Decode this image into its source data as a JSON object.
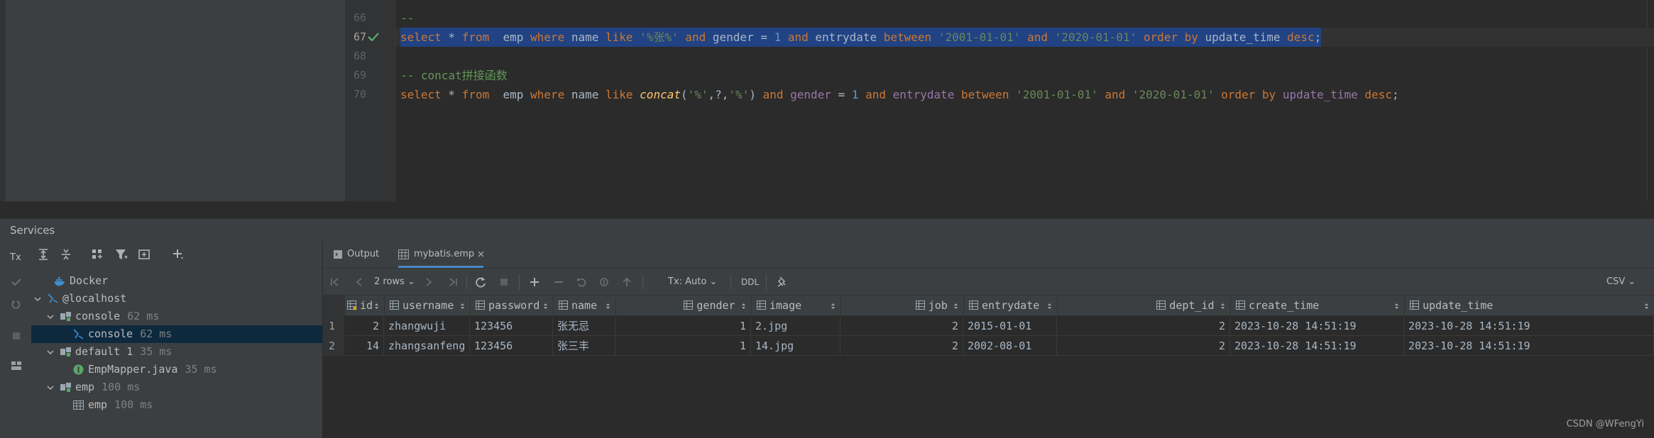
{
  "editor": {
    "lines": [
      {
        "n": "66",
        "tokens": [
          {
            "t": "--",
            "c": "cmt"
          }
        ]
      },
      {
        "n": "67",
        "current": true,
        "check": true,
        "selected": true,
        "tokens": [
          {
            "t": "select",
            "c": "kw"
          },
          {
            "t": " * "
          },
          {
            "t": "from",
            "c": "kw"
          },
          {
            "t": "  emp "
          },
          {
            "t": "where",
            "c": "kw"
          },
          {
            "t": " name "
          },
          {
            "t": "like",
            "c": "kw"
          },
          {
            "t": " "
          },
          {
            "t": "'%张%'",
            "c": "str"
          },
          {
            "t": " "
          },
          {
            "t": "and",
            "c": "kw"
          },
          {
            "t": " gender = "
          },
          {
            "t": "1",
            "c": "num-l"
          },
          {
            "t": " "
          },
          {
            "t": "and",
            "c": "kw"
          },
          {
            "t": " entrydate "
          },
          {
            "t": "between",
            "c": "kw"
          },
          {
            "t": " "
          },
          {
            "t": "'2001-01-01'",
            "c": "str"
          },
          {
            "t": " "
          },
          {
            "t": "and",
            "c": "kw"
          },
          {
            "t": " "
          },
          {
            "t": "'2020-01-01'",
            "c": "str"
          },
          {
            "t": " "
          },
          {
            "t": "order by",
            "c": "kw"
          },
          {
            "t": " update_time "
          },
          {
            "t": "desc",
            "c": "kw"
          },
          {
            "t": ";"
          }
        ]
      },
      {
        "n": "68",
        "tokens": []
      },
      {
        "n": "69",
        "tokens": [
          {
            "t": "-- concat拼接函数",
            "c": "cmt"
          }
        ]
      },
      {
        "n": "70",
        "tokens": [
          {
            "t": "select",
            "c": "kw"
          },
          {
            "t": " * "
          },
          {
            "t": "from",
            "c": "kw"
          },
          {
            "t": "  emp "
          },
          {
            "t": "where",
            "c": "kw"
          },
          {
            "t": " name "
          },
          {
            "t": "like",
            "c": "kw"
          },
          {
            "t": " "
          },
          {
            "t": "concat",
            "c": "fn"
          },
          {
            "t": "("
          },
          {
            "t": "'%'",
            "c": "str"
          },
          {
            "t": ",?,"
          },
          {
            "t": "'%'",
            "c": "str"
          },
          {
            "t": ") "
          },
          {
            "t": "and",
            "c": "kw"
          },
          {
            "t": " "
          },
          {
            "t": "gender",
            "c": "col"
          },
          {
            "t": " = "
          },
          {
            "t": "1",
            "c": "num-l"
          },
          {
            "t": " "
          },
          {
            "t": "and",
            "c": "kw"
          },
          {
            "t": " "
          },
          {
            "t": "entrydate",
            "c": "col"
          },
          {
            "t": " "
          },
          {
            "t": "between",
            "c": "kw"
          },
          {
            "t": " "
          },
          {
            "t": "'2001-01-01'",
            "c": "str"
          },
          {
            "t": " "
          },
          {
            "t": "and",
            "c": "kw"
          },
          {
            "t": " "
          },
          {
            "t": "'2020-01-01'",
            "c": "str"
          },
          {
            "t": " "
          },
          {
            "t": "order by",
            "c": "kw"
          },
          {
            "t": " "
          },
          {
            "t": "update_time",
            "c": "col"
          },
          {
            "t": " "
          },
          {
            "t": "desc",
            "c": "kw"
          },
          {
            "t": ";"
          }
        ]
      }
    ]
  },
  "services": {
    "title": "Services",
    "left_tools": {
      "tx": "Tx"
    },
    "tree": [
      {
        "label": "Docker",
        "time": "",
        "icon": "docker-icon"
      },
      {
        "label": "@localhost",
        "time": "",
        "icon": "database-connection-icon"
      },
      {
        "label": "console",
        "time": "62 ms",
        "icon": "console-session-icon"
      },
      {
        "label": "console",
        "time": "62 ms",
        "icon": "console-file-icon",
        "selected": true
      },
      {
        "label": "default 1",
        "time": "35 ms",
        "icon": "console-session-icon"
      },
      {
        "label": "EmpMapper.java",
        "time": "35 ms",
        "icon": "java-interface-icon"
      },
      {
        "label": "emp",
        "time": "100 ms",
        "icon": "console-session-icon"
      },
      {
        "label": "emp",
        "time": "100 ms",
        "icon": "table-icon"
      }
    ]
  },
  "results": {
    "tabs": [
      {
        "label": "Output",
        "active": false
      },
      {
        "label": "mybatis.emp",
        "active": true
      }
    ],
    "toolbar": {
      "rows_label": "2 rows",
      "tx_label": "Tx: Auto",
      "ddl_label": "DDL",
      "export_label": "CSV"
    },
    "columns": [
      "id",
      "username",
      "password",
      "name",
      "gender",
      "image",
      "job",
      "entrydate",
      "dept_id",
      "create_time",
      "update_time"
    ],
    "rows": [
      {
        "n": "1",
        "cells": [
          "2",
          "zhangwuji",
          "123456",
          "张无忌",
          "1",
          "2.jpg",
          "2",
          "2015-01-01",
          "2",
          "2023-10-28 14:51:19",
          "2023-10-28 14:51:19"
        ]
      },
      {
        "n": "2",
        "cells": [
          "14",
          "zhangsanfeng",
          "123456",
          "张三丰",
          "1",
          "14.jpg",
          "2",
          "2002-08-01",
          "2",
          "2023-10-28 14:51:19",
          "2023-10-28 14:51:19"
        ]
      }
    ]
  },
  "watermark": "CSDN @WFengYi",
  "colors": {
    "editor_bg": "#2b2b2b",
    "panel_bg": "#3c3f41",
    "selection": "#214283",
    "keyword": "#cc7832",
    "string": "#6a8759",
    "number": "#6897bb",
    "comment": "#629755",
    "accent": "#4a88c7",
    "check_green": "#59a869"
  }
}
